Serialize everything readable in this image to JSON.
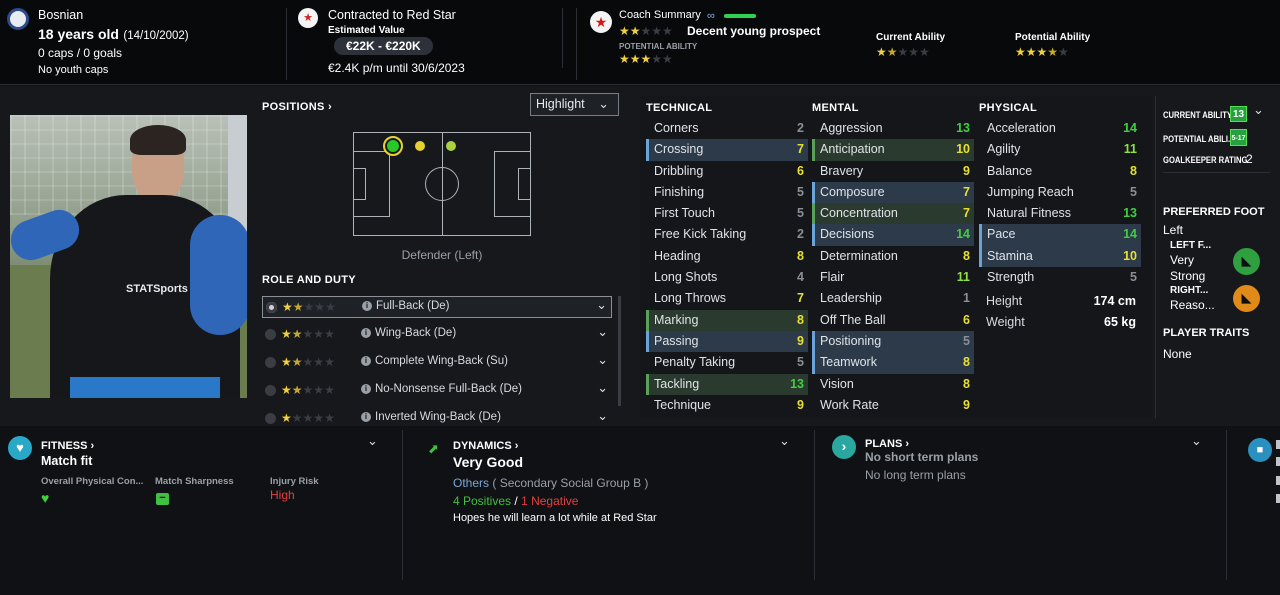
{
  "header": {
    "nationality": "Bosnian",
    "age": "18 years old",
    "dob": "(14/10/2002)",
    "caps": "0 caps / 0 goals",
    "youth_caps": "No youth caps",
    "contract": "Contracted to Red Star",
    "est_value_label": "Estimated Value",
    "est_value": "€22K - €220K",
    "wage": "€2.4K p/m until 30/6/2023",
    "coach_summary_label": "Coach Summary",
    "coach_summary": "Decent young prospect",
    "potential_label": "POTENTIAL ABILITY",
    "current_ability_label": "Current Ability",
    "potential_ability_label": "Potential Ability"
  },
  "positions": {
    "title": "POSITIONS",
    "highlight": "Highlight",
    "position_name": "Defender (Left)"
  },
  "roles": {
    "title": "ROLE AND DUTY",
    "items": [
      {
        "label": "Full-Back (De)",
        "stars": 1.5
      },
      {
        "label": "Wing-Back (De)",
        "stars": 1.5
      },
      {
        "label": "Complete Wing-Back (Su)",
        "stars": 1.5
      },
      {
        "label": "No-Nonsense Full-Back (De)",
        "stars": 1.5
      },
      {
        "label": "Inverted Wing-Back (De)",
        "stars": 1
      }
    ]
  },
  "technical": {
    "title": "TECHNICAL",
    "items": [
      {
        "name": "Corners",
        "value": "2"
      },
      {
        "name": "Crossing",
        "value": "7"
      },
      {
        "name": "Dribbling",
        "value": "6"
      },
      {
        "name": "Finishing",
        "value": "5"
      },
      {
        "name": "First Touch",
        "value": "5"
      },
      {
        "name": "Free Kick Taking",
        "value": "2"
      },
      {
        "name": "Heading",
        "value": "8"
      },
      {
        "name": "Long Shots",
        "value": "4"
      },
      {
        "name": "Long Throws",
        "value": "7"
      },
      {
        "name": "Marking",
        "value": "8"
      },
      {
        "name": "Passing",
        "value": "9"
      },
      {
        "name": "Penalty Taking",
        "value": "5"
      },
      {
        "name": "Tackling",
        "value": "13"
      },
      {
        "name": "Technique",
        "value": "9"
      }
    ]
  },
  "mental": {
    "title": "MENTAL",
    "items": [
      {
        "name": "Aggression",
        "value": "13"
      },
      {
        "name": "Anticipation",
        "value": "10"
      },
      {
        "name": "Bravery",
        "value": "9"
      },
      {
        "name": "Composure",
        "value": "7"
      },
      {
        "name": "Concentration",
        "value": "7"
      },
      {
        "name": "Decisions",
        "value": "14"
      },
      {
        "name": "Determination",
        "value": "8"
      },
      {
        "name": "Flair",
        "value": "11"
      },
      {
        "name": "Leadership",
        "value": "1"
      },
      {
        "name": "Off The Ball",
        "value": "6"
      },
      {
        "name": "Positioning",
        "value": "5"
      },
      {
        "name": "Teamwork",
        "value": "8"
      },
      {
        "name": "Vision",
        "value": "8"
      },
      {
        "name": "Work Rate",
        "value": "9"
      }
    ]
  },
  "physical": {
    "title": "PHYSICAL",
    "items": [
      {
        "name": "Acceleration",
        "value": "14"
      },
      {
        "name": "Agility",
        "value": "11"
      },
      {
        "name": "Balance",
        "value": "8"
      },
      {
        "name": "Jumping Reach",
        "value": "5"
      },
      {
        "name": "Natural Fitness",
        "value": "13"
      },
      {
        "name": "Pace",
        "value": "14"
      },
      {
        "name": "Stamina",
        "value": "10"
      },
      {
        "name": "Strength",
        "value": "5"
      }
    ],
    "height_label": "Height",
    "height": "174 cm",
    "weight_label": "Weight",
    "weight": "65 kg"
  },
  "side": {
    "ca_label": "CURRENT ABILITY",
    "ca_value": "13",
    "pa_label": "POTENTIAL ABILI...",
    "pa_value": "5-17",
    "gk_label": "GOALKEEPER RATING",
    "gk_value": "2",
    "foot_title": "PREFERRED FOOT",
    "foot": "Left",
    "left_foot_label": "LEFT F...",
    "left_foot_value": "Very Strong",
    "right_foot_label": "RIGHT...",
    "right_foot_value": "Reaso...",
    "traits_title": "PLAYER TRAITS",
    "traits": "None"
  },
  "fitness": {
    "title": "FITNESS",
    "status": "Match fit",
    "overall_label": "Overall Physical Con...",
    "sharpness_label": "Match Sharpness",
    "injury_label": "Injury Risk",
    "injury_value": "High"
  },
  "dynamics": {
    "title": "DYNAMICS",
    "status": "Very Good",
    "group": "Others",
    "group_detail": "( Secondary Social Group B )",
    "positives": "4 Positives",
    "sep": "/",
    "negatives": "1 Negative",
    "note": "Hopes he will learn a lot while at Red Star"
  },
  "plans": {
    "title": "PLANS",
    "short": "No short term plans",
    "long": "No long term plans"
  },
  "photo": {
    "shirt_text": "STATSports"
  }
}
